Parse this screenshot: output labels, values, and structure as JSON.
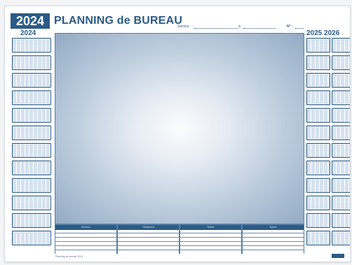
{
  "header": {
    "year_badge": "2024",
    "title": "PLANNING de BUREAU",
    "service_label": "Service :",
    "at_label": "à :",
    "number_label": "N° :"
  },
  "calendars": {
    "left_year": "2024",
    "right_years": "2025 2026"
  },
  "notes": [
    {
      "label": "Bureau"
    },
    {
      "label": "Téléphone"
    },
    {
      "label": "Notes"
    },
    {
      "label": "Notes"
    }
  ],
  "footer": {
    "text": "Planning de bureau 2024"
  },
  "colors": {
    "brand": "#2b5b86",
    "panel_center": "#fbfcfe",
    "panel_edge": "#92abc4"
  }
}
